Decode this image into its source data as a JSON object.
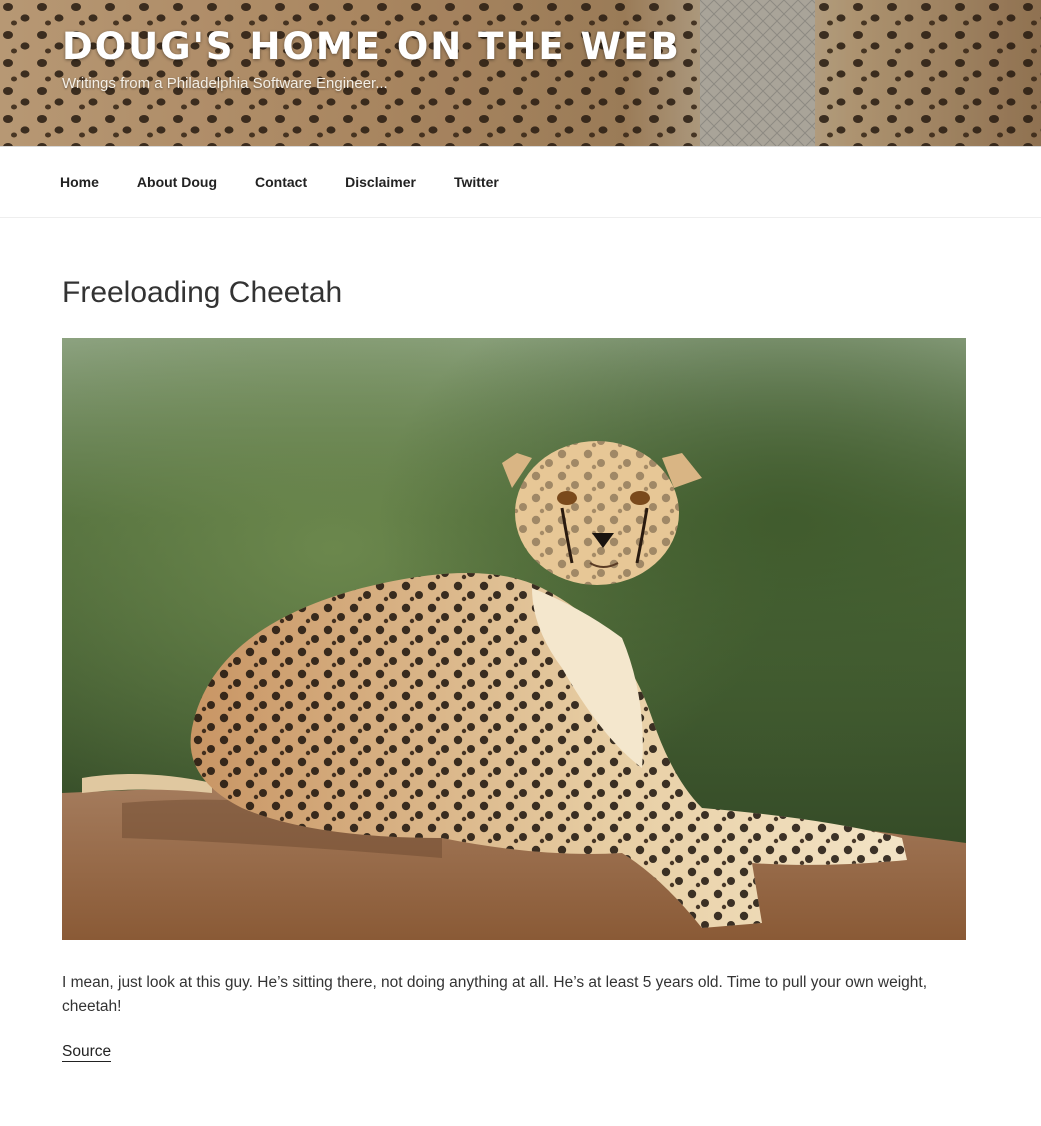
{
  "header": {
    "site_title": "DOUG'S HOME ON THE WEB",
    "site_description": "Writings from a Philadelphia Software Engineer..."
  },
  "nav": {
    "items": [
      {
        "label": "Home"
      },
      {
        "label": "About Doug"
      },
      {
        "label": "Contact"
      },
      {
        "label": "Disclaimer"
      },
      {
        "label": "Twitter"
      }
    ]
  },
  "post": {
    "title": "Freeloading Cheetah",
    "image_icon": "cheetah-photo",
    "body": "I mean, just look at this guy. He’s sitting there, not doing anything at all. He’s at least 5 years old. Time to pull your own weight, cheetah!",
    "source_label": "Source"
  }
}
